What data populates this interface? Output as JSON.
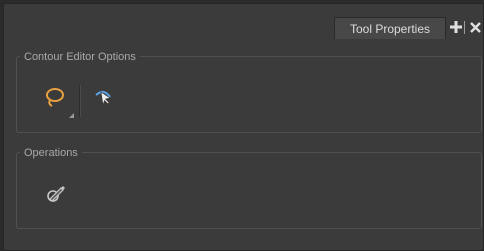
{
  "tab": {
    "label": "Tool Properties"
  },
  "header_buttons": {
    "add": "add-icon",
    "close": "close-icon"
  },
  "contour_group": {
    "title": "Contour Editor Options",
    "tools": [
      {
        "name": "lasso-select-icon",
        "color": "#e8a040",
        "has_menu": true
      },
      {
        "name": "contour-editor-icon",
        "color": "#5aa0e0"
      }
    ]
  },
  "operations_group": {
    "title": "Operations",
    "tools": [
      {
        "name": "pencil-stroke-icon"
      }
    ]
  },
  "colors": {
    "accent_orange": "#e8a040",
    "accent_blue": "#5aa0e0"
  }
}
